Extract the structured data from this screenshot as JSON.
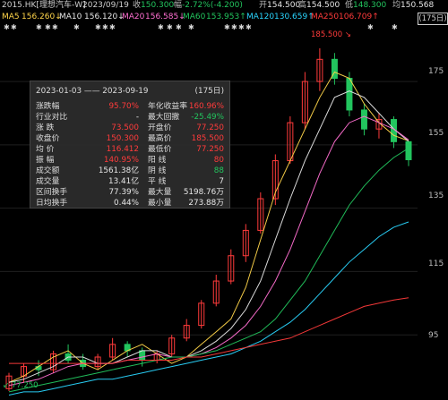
{
  "header": {
    "name": "2015.HK[理想汽车-W]",
    "date": "2023/09/19",
    "open_label": "收",
    "open_value": "150.300",
    "change_label": "幅",
    "change_value": "-2.72%(-4.200)",
    "open2_label": "开",
    "open2_value": "154.500",
    "high_label": "高",
    "high_value": "154.500",
    "low_label": "低",
    "low_value": "148.300",
    "avg_label": "均",
    "avg_value": "150.568"
  },
  "ma": [
    {
      "label": "MA5",
      "value": "156.260↓",
      "color": "#ffd54a"
    },
    {
      "label": "MA10",
      "value": "156.120↓",
      "color": "#e6e6e6"
    },
    {
      "label": "MA20",
      "value": "156.585↓",
      "color": "#ff6fd1"
    },
    {
      "label": "MA60",
      "value": "153.953↑",
      "color": "#22c55e"
    },
    {
      "label": "MA120",
      "value": "130.659↑",
      "color": "#2ad6ff"
    },
    {
      "label": "MA250",
      "value": "106.709↑",
      "color": "#ff3b3b"
    }
  ],
  "range_days": "(175日)",
  "info_box": {
    "title": "2023-01-03 —— 2023-09-19",
    "title_badge": "(175日)",
    "rows": [
      {
        "k": "涨跌幅",
        "v": "95.70%",
        "vcolor": "#ff3b3b",
        "k2": "年化收益率",
        "v2": "160.96%",
        "v2color": "#ff3b3b"
      },
      {
        "k": "行业对比",
        "v": "-",
        "vcolor": "#e6e6e6",
        "k2": "最大回撤",
        "v2": "-25.49%",
        "v2color": "#22c55e"
      },
      {
        "k": "涨    跌",
        "v": "73.500",
        "vcolor": "#ff3b3b",
        "k2": "开盘价",
        "v2": "77.250",
        "v2color": "#ff3b3b"
      },
      {
        "k": "收盘价",
        "v": "150.300",
        "vcolor": "#ff3b3b",
        "k2": "最高价",
        "v2": "185.500",
        "v2color": "#ff3b3b"
      },
      {
        "k": "均    价",
        "v": "116.412",
        "vcolor": "#ff3b3b",
        "k2": "最低价",
        "v2": "77.250",
        "v2color": "#ff3b3b"
      },
      {
        "k": "振    幅",
        "v": "140.95%",
        "vcolor": "#ff3b3b",
        "k2": "阳    线",
        "v2": "80",
        "v2color": "#ff3b3b"
      },
      {
        "k": "成交额",
        "v": "1561.38亿",
        "vcolor": "#e6e6e6",
        "k2": "阴    线",
        "v2": "88",
        "v2color": "#22c55e"
      },
      {
        "k": "成交量",
        "v": "13.41亿",
        "vcolor": "#e6e6e6",
        "k2": "平    线",
        "v2": "7",
        "v2color": "#e6e6e6"
      },
      {
        "k": "区间换手",
        "v": "77.39%",
        "vcolor": "#e6e6e6",
        "k2": "最大量",
        "v2": "5198.76万",
        "v2color": "#e6e6e6"
      },
      {
        "k": "日均换手",
        "v": "0.44%",
        "vcolor": "#e6e6e6",
        "k2": "最小量",
        "v2": "273.88万",
        "v2color": "#e6e6e6"
      }
    ]
  },
  "annotations": {
    "high": "185.500",
    "low": "77.250"
  },
  "chart_data": {
    "type": "line",
    "y_ticks": [
      175,
      155,
      135,
      115,
      95
    ],
    "ylim": [
      75,
      190
    ],
    "x": {
      "start": "2023-01-03",
      "end": "2023-09-19",
      "count": 175
    },
    "series": [
      {
        "name": "MA5",
        "values": [
          80,
          82,
          85,
          88,
          90,
          86,
          84,
          87,
          90,
          92,
          89,
          86,
          88,
          92,
          96,
          100,
          110,
          125,
          140,
          150,
          160,
          170,
          178,
          176,
          168,
          162,
          158,
          156.26
        ]
      },
      {
        "name": "MA10",
        "values": [
          80,
          81,
          83,
          85,
          88,
          88,
          86,
          86,
          88,
          90,
          90,
          88,
          88,
          90,
          93,
          97,
          103,
          112,
          125,
          138,
          150,
          160,
          170,
          172,
          170,
          165,
          160,
          156.12
        ]
      },
      {
        "name": "MA20",
        "values": [
          79,
          80,
          81,
          83,
          85,
          86,
          86,
          86,
          87,
          88,
          89,
          88,
          88,
          89,
          91,
          94,
          98,
          104,
          112,
          122,
          134,
          146,
          156,
          162,
          164,
          162,
          160,
          156.585
        ]
      },
      {
        "name": "MA60",
        "values": [
          77,
          78,
          79,
          80,
          81,
          82,
          83,
          84,
          85,
          86,
          87,
          88,
          88,
          89,
          90,
          92,
          94,
          96,
          100,
          106,
          112,
          120,
          128,
          136,
          142,
          147,
          151,
          153.953
        ]
      },
      {
        "name": "MA120",
        "values": [
          76,
          77,
          77,
          78,
          79,
          80,
          81,
          81,
          82,
          83,
          84,
          85,
          86,
          87,
          88,
          89,
          91,
          93,
          96,
          99,
          103,
          108,
          113,
          118,
          122,
          126,
          129,
          130.659
        ]
      },
      {
        "name": "MA250",
        "values": [
          86,
          86,
          86,
          86,
          86,
          86,
          86,
          86,
          87,
          87,
          87,
          87,
          88,
          88,
          89,
          90,
          91,
          92,
          93,
          94,
          96,
          98,
          100,
          102,
          104,
          105,
          106,
          106.709
        ]
      }
    ],
    "candles": [
      {
        "o": 78,
        "c": 82,
        "h": 83,
        "l": 77.25
      },
      {
        "o": 82,
        "c": 85,
        "h": 86,
        "l": 80
      },
      {
        "o": 85,
        "c": 84,
        "h": 87,
        "l": 82
      },
      {
        "o": 84,
        "c": 89,
        "h": 90,
        "l": 83
      },
      {
        "o": 89,
        "c": 87,
        "h": 92,
        "l": 86
      },
      {
        "o": 87,
        "c": 85,
        "h": 89,
        "l": 84
      },
      {
        "o": 85,
        "c": 88,
        "h": 89,
        "l": 84
      },
      {
        "o": 88,
        "c": 92,
        "h": 94,
        "l": 87
      },
      {
        "o": 92,
        "c": 90,
        "h": 93,
        "l": 88
      },
      {
        "o": 90,
        "c": 87,
        "h": 91,
        "l": 85
      },
      {
        "o": 87,
        "c": 89,
        "h": 90,
        "l": 86
      },
      {
        "o": 89,
        "c": 94,
        "h": 95,
        "l": 88
      },
      {
        "o": 94,
        "c": 98,
        "h": 100,
        "l": 93
      },
      {
        "o": 98,
        "c": 105,
        "h": 106,
        "l": 97
      },
      {
        "o": 105,
        "c": 112,
        "h": 114,
        "l": 104
      },
      {
        "o": 112,
        "c": 120,
        "h": 122,
        "l": 111
      },
      {
        "o": 120,
        "c": 128,
        "h": 130,
        "l": 118
      },
      {
        "o": 128,
        "c": 138,
        "h": 140,
        "l": 127
      },
      {
        "o": 138,
        "c": 150,
        "h": 152,
        "l": 136
      },
      {
        "o": 150,
        "c": 162,
        "h": 164,
        "l": 149
      },
      {
        "o": 162,
        "c": 175,
        "h": 178,
        "l": 160
      },
      {
        "o": 175,
        "c": 182,
        "h": 185.5,
        "l": 172
      },
      {
        "o": 182,
        "c": 176,
        "h": 184,
        "l": 174
      },
      {
        "o": 176,
        "c": 166,
        "h": 178,
        "l": 164
      },
      {
        "o": 166,
        "c": 160,
        "h": 168,
        "l": 158
      },
      {
        "o": 160,
        "c": 163,
        "h": 165,
        "l": 157
      },
      {
        "o": 163,
        "c": 156,
        "h": 164,
        "l": 154
      },
      {
        "o": 156,
        "c": 150.3,
        "h": 154.5,
        "l": 148.3
      }
    ]
  }
}
